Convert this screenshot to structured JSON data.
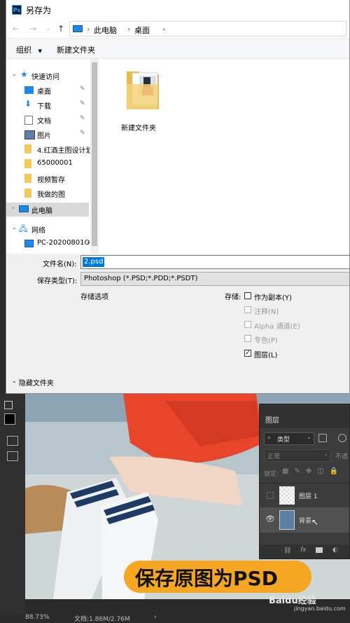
{
  "dialog": {
    "app_icon": "photoshop-icon",
    "title": "另存为",
    "breadcrumb": [
      "此电脑",
      "桌面"
    ],
    "toolbar": {
      "organize": "组织",
      "organize_arrow": "▼",
      "new_folder": "新建文件夹"
    },
    "sidebar": {
      "quick_access": "快速访问",
      "items": [
        {
          "label": "桌面",
          "icon": "desktop-icon",
          "pinned": true
        },
        {
          "label": "下载",
          "icon": "download-icon",
          "pinned": true
        },
        {
          "label": "文档",
          "icon": "document-icon",
          "pinned": true
        },
        {
          "label": "图片",
          "icon": "picture-icon",
          "pinned": true
        },
        {
          "label": "4.红酒主图设计划",
          "icon": "folder-icon",
          "pinned": false
        },
        {
          "label": "65000001",
          "icon": "folder-icon",
          "pinned": false
        },
        {
          "label": "视频暂存",
          "icon": "folder-icon",
          "pinned": false
        },
        {
          "label": "我做的图",
          "icon": "folder-icon",
          "pinned": false
        }
      ],
      "this_pc": "此电脑",
      "network": "网络",
      "pc_name": "PC-20200801O"
    },
    "files": [
      {
        "name": "新建文件夹"
      }
    ],
    "filename_label": "文件名(N):",
    "filename_value": "2.psd",
    "savetype_label": "保存类型(T):",
    "savetype_value": "Photoshop (*.PSD;*.PDD;*.PSDT)",
    "save_options_label": "存储选项",
    "save_label": "存储:",
    "options": [
      {
        "label": "作为副本(Y)",
        "checked": false,
        "enabled": true
      },
      {
        "label": "注释(N)",
        "checked": false,
        "enabled": false
      },
      {
        "label": "Alpha 通道(E)",
        "checked": false,
        "enabled": false
      },
      {
        "label": "专色(P)",
        "checked": false,
        "enabled": false
      },
      {
        "label": "图层(L)",
        "checked": true,
        "enabled": true
      }
    ],
    "hide_folders": "隐藏文件夹"
  },
  "photoshop": {
    "layers_tab": "图层",
    "filter_kind": "类型",
    "blend_mode": "正常",
    "opacity_label": "不透",
    "lock_label": "锁定:",
    "layers": [
      {
        "name": "图层 1",
        "visible": false
      },
      {
        "name": "背景",
        "visible": true
      }
    ],
    "caption": "保存原图为PSD",
    "zoom": "88.73%",
    "doc_info": "文档:1.86M/2.76M",
    "watermark": "Baidu经验",
    "watermark_url": "jingyan.baidu.com"
  },
  "colors": {
    "caption_bg": "#f5a623",
    "selection_blue": "#0078d7",
    "ps_dark": "#2f2f2f"
  }
}
